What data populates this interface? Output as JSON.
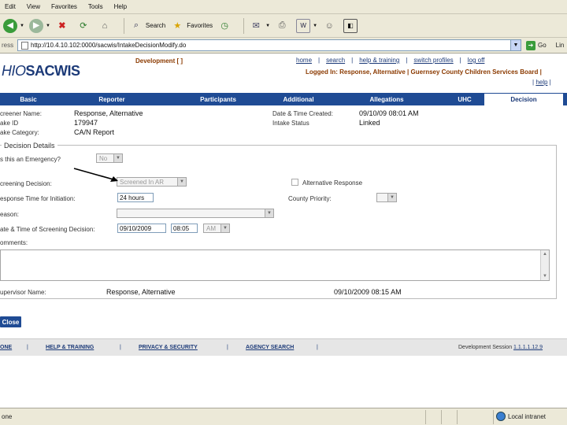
{
  "browser": {
    "menu": [
      "Edit",
      "View",
      "Favorites",
      "Tools",
      "Help"
    ],
    "toolbar": {
      "search_label": "Search",
      "favorites_label": "Favorites"
    },
    "address_label": "ress",
    "url": "http://10.4.10.102:0000/sacwis/IntakeDecisionModify.do",
    "go_label": "Go",
    "links_label": "Lin"
  },
  "app": {
    "logo_ohio": "HIO",
    "logo_sacwis": "SACWIS",
    "env_label": "Development [ ]",
    "nav": [
      "home",
      "search",
      "help & training",
      "switch profiles",
      "log off"
    ],
    "logged_in": "Logged In: Response, Alternative | Guernsey County Children Services Board |",
    "help_link": "help"
  },
  "tabs": [
    "Basic",
    "Reporter",
    "Participants",
    "Additional",
    "Allegations",
    "UHC",
    "Decision"
  ],
  "active_tab": "Decision",
  "intake": {
    "screener_label": "creener Name:",
    "screener_value": "Response, Alternative",
    "intake_id_label": "ake ID",
    "intake_id_value": "179947",
    "category_label": "ake Category:",
    "category_value": "CA/N Report",
    "created_label": "Date & Time Created:",
    "created_value": "09/10/09 08:01 AM",
    "status_label": "Intake Status",
    "status_value": "Linked"
  },
  "details": {
    "legend": "Decision Details",
    "emergency_label": "s this an Emergency?",
    "emergency_value": "No",
    "screening_label": "creening Decision:",
    "screening_value": "Screened In AR",
    "alt_response_label": "Alternative Response",
    "response_time_label": "esponse Time for Initiation:",
    "response_time_value": "24 hours",
    "county_priority_label": "County Priority:",
    "reason_label": "eason:",
    "date_time_label": "ate & Time of Screening Decision:",
    "date_value": "09/10/2009",
    "time_value": "08:05",
    "ampm_value": "AM",
    "comments_label": "omments:",
    "supervisor_label": "upervisor Name:",
    "supervisor_value": "Response, Alternative",
    "supervisor_date": "09/10/2009 08:15 AM"
  },
  "close_label": "Close",
  "footer": {
    "links": [
      "ONE",
      "HELP & TRAINING",
      "PRIVACY & SECURITY",
      "AGENCY SEARCH"
    ],
    "dev_session_label": "Development Session",
    "version": "1.1.1.1.12.9"
  },
  "status": {
    "left": "one",
    "zone": "Local intranet"
  }
}
